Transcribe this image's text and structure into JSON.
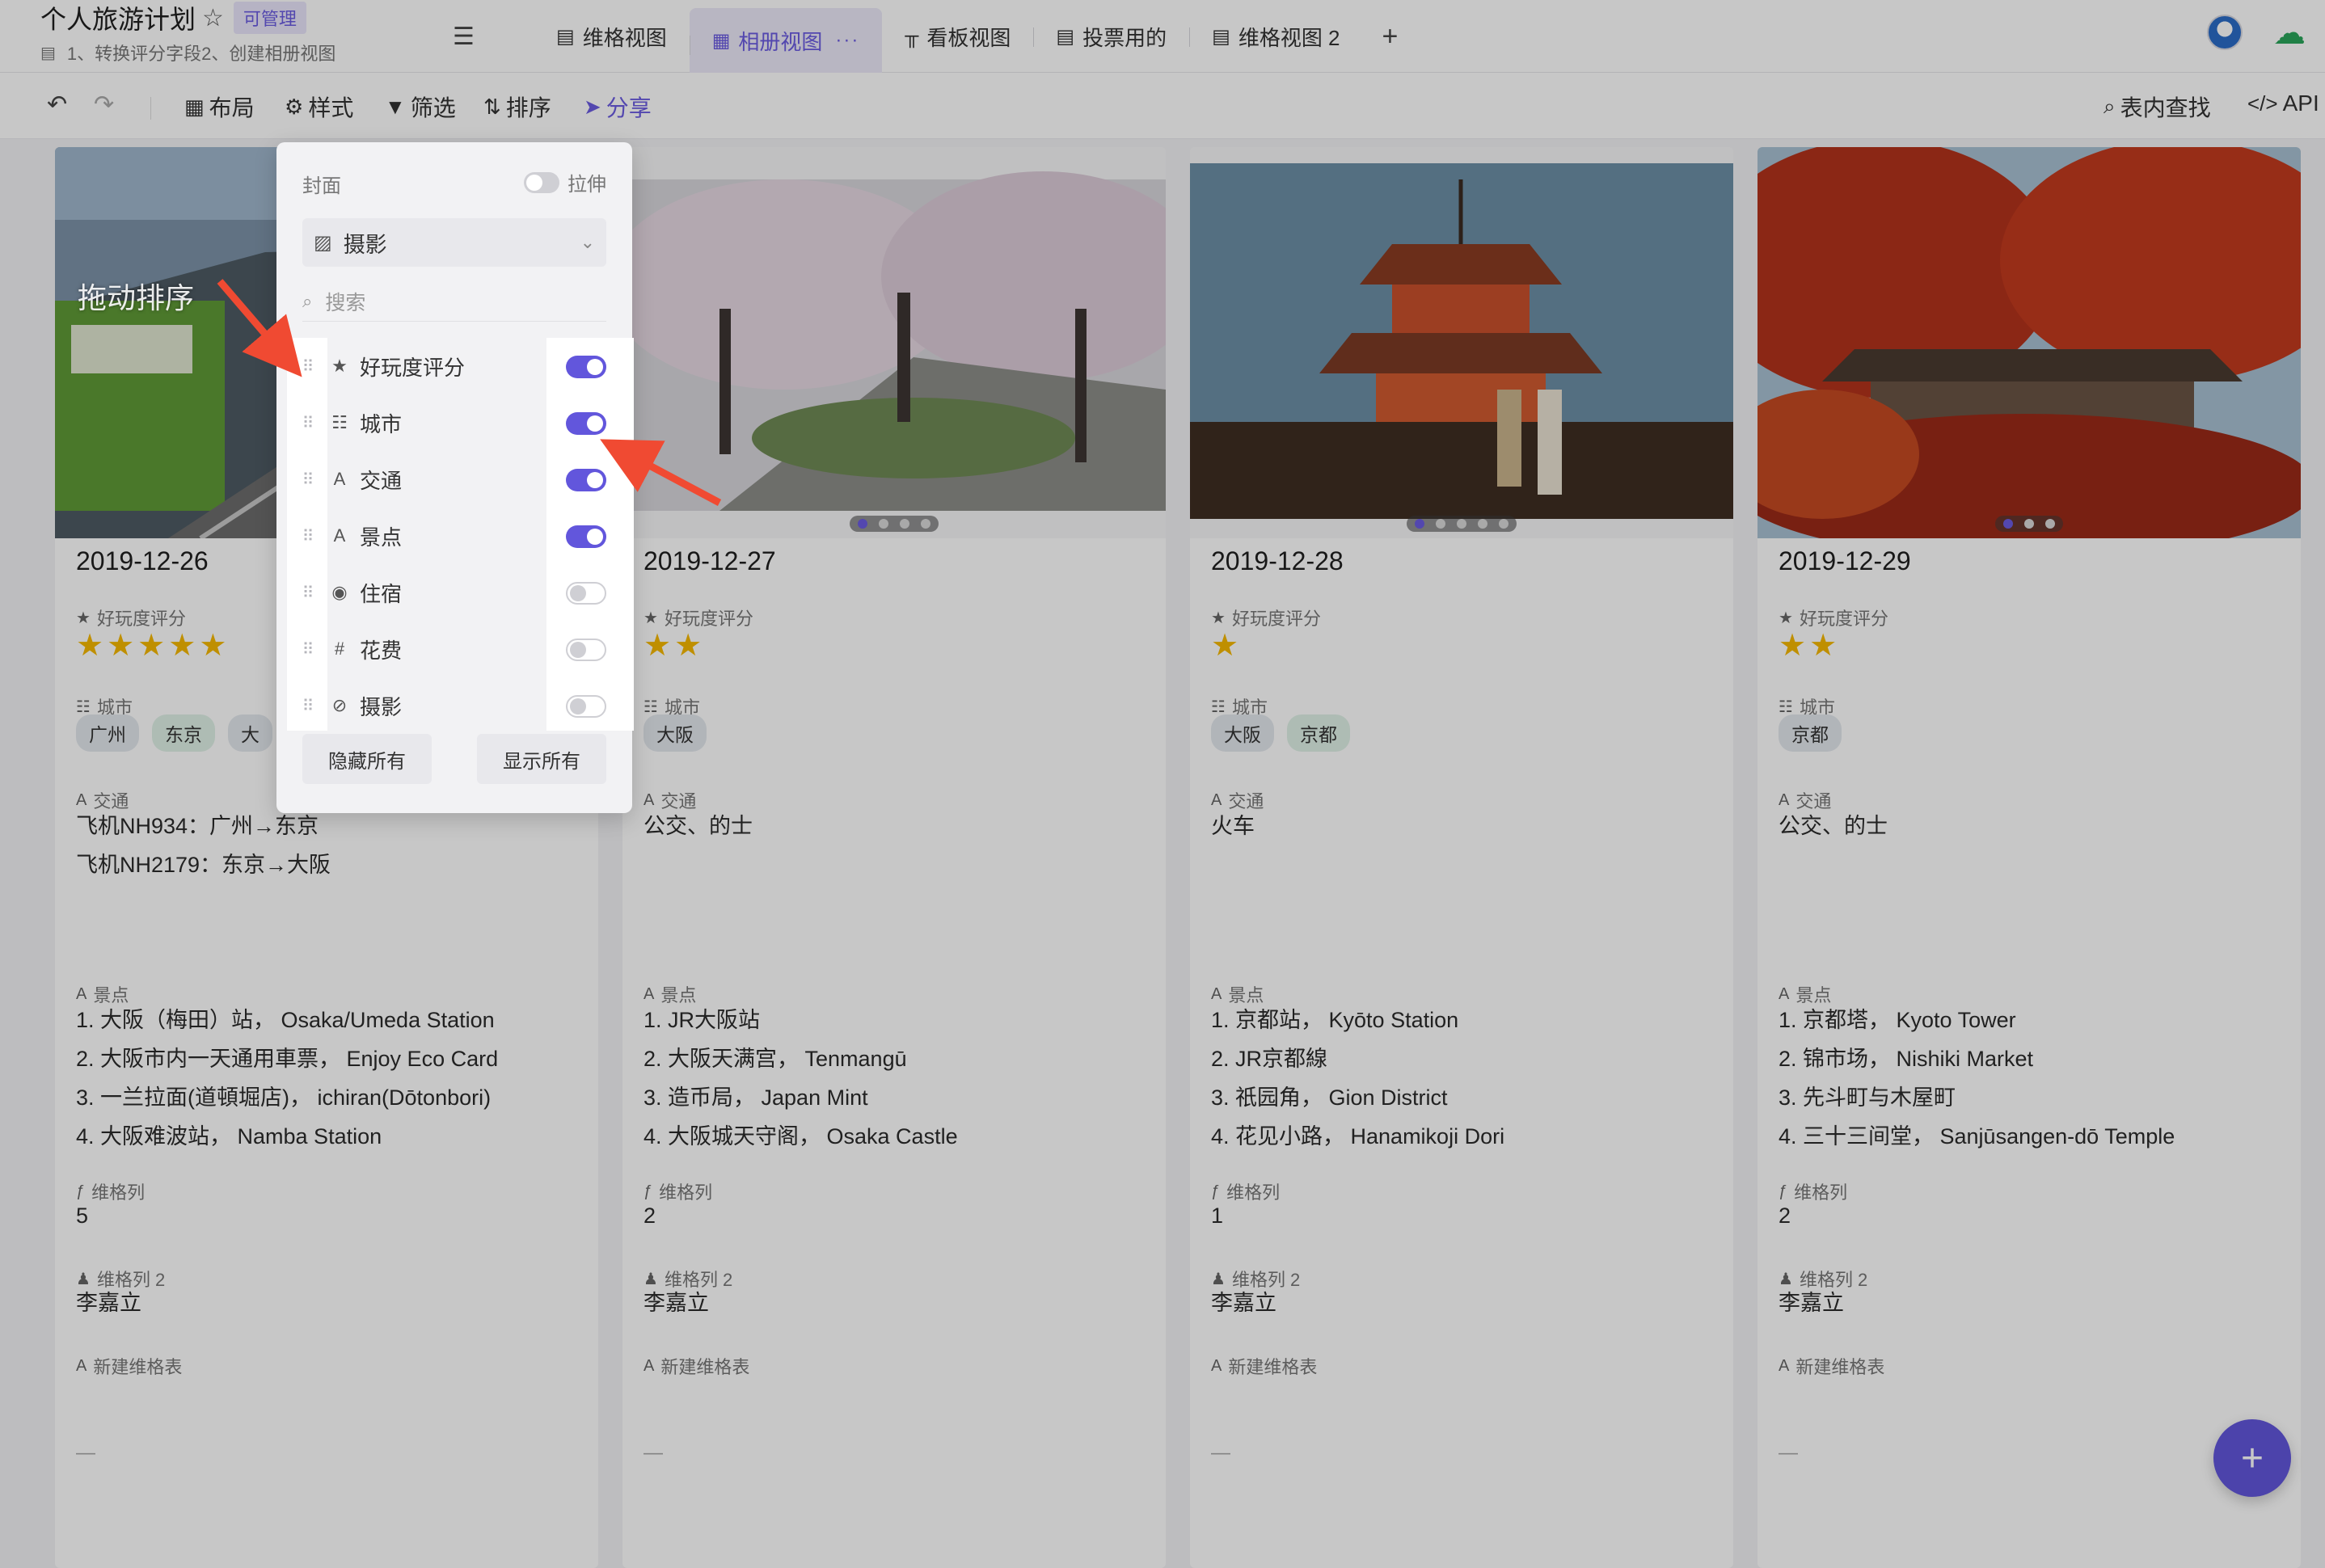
{
  "header": {
    "title": "个人旅游计划",
    "permission_badge": "可管理",
    "description": "1、转换评分字段2、创建相册视图",
    "tabs": [
      {
        "label": "维格视图",
        "icon": "grid-view-icon"
      },
      {
        "label": "相册视图",
        "icon": "gallery-view-icon",
        "active": true
      },
      {
        "label": "看板视图",
        "icon": "kanban-view-icon"
      },
      {
        "label": "投票用的",
        "icon": "grid-view-icon"
      },
      {
        "label": "维格视图 2",
        "icon": "grid-view-icon"
      }
    ],
    "add_tab": "+"
  },
  "toolbar": {
    "layout": "布局",
    "style": "样式",
    "filter": "筛选",
    "sort": "排序",
    "share": "分享",
    "find": "表内查找",
    "api": "API"
  },
  "panel": {
    "cover_label": "封面",
    "stretch_label": "拉伸",
    "cover_select": "摄影",
    "search_placeholder": "搜索",
    "fields": [
      {
        "name": "好玩度评分",
        "icon": "star-icon",
        "visible": true
      },
      {
        "name": "城市",
        "icon": "multi-select-icon",
        "visible": true
      },
      {
        "name": "交通",
        "icon": "text-icon",
        "visible": true
      },
      {
        "name": "景点",
        "icon": "text-icon",
        "visible": true
      },
      {
        "name": "住宿",
        "icon": "single-select-icon",
        "visible": false
      },
      {
        "name": "花费",
        "icon": "number-icon",
        "visible": false
      },
      {
        "name": "摄影",
        "icon": "attachment-icon",
        "visible": false
      }
    ],
    "hide_all": "隐藏所有",
    "show_all": "显示所有"
  },
  "annotation": {
    "drag_sort": "拖动排序"
  },
  "field_labels": {
    "rating": "好玩度评分",
    "city": "城市",
    "traffic": "交通",
    "spots": "景点",
    "formula": "维格列",
    "member": "维格列 2",
    "newsheet": "新建维格表"
  },
  "cards": [
    {
      "date": "2019-12-26",
      "rating": 5,
      "cities": [
        "广州",
        "东京",
        "大"
      ],
      "traffic": [
        "飞机NH934：广州→东京",
        "飞机NH2179：东京→大阪"
      ],
      "spots": [
        "1. 大阪（梅田）站，  Osaka/Umeda Station",
        "2. 大阪市内一天通用車票，  Enjoy Eco Card",
        "3. 一兰拉面(道頓堀店)，  ichiran(Dōtonbori)",
        "4. 大阪难波站，  Namba Station"
      ],
      "formula": "5",
      "member": "李嘉立",
      "newsheet": "—",
      "pager": 0
    },
    {
      "date": "2019-12-27",
      "rating": 2,
      "cities": [
        "大阪"
      ],
      "traffic": [
        "公交、的士"
      ],
      "spots": [
        "1. JR大阪站",
        "2. 大阪天满宫，  Tenmangū",
        "3. 造币局，  Japan Mint",
        "4. 大阪城天守阁，  Osaka Castle"
      ],
      "formula": "2",
      "member": "李嘉立",
      "newsheet": "—",
      "pager": 4
    },
    {
      "date": "2019-12-28",
      "rating": 1,
      "cities": [
        "大阪",
        "京都"
      ],
      "traffic": [
        "火车"
      ],
      "spots": [
        "1. 京都站，  Kyōto Station",
        "2. JR京都線",
        "3. 祇园角，  Gion District",
        "4. 花见小路，  Hanamikoji Dori"
      ],
      "formula": "1",
      "member": "李嘉立",
      "newsheet": "—",
      "pager": 5
    },
    {
      "date": "2019-12-29",
      "rating": 2,
      "cities": [
        "京都"
      ],
      "traffic": [
        "公交、的士"
      ],
      "spots": [
        "1. 京都塔，  Kyoto Tower",
        "2. 锦市场，  Nishiki Market",
        "3. 先斗町与木屋町",
        "4. 三十三间堂，  Sanjūsangen-dō Temple"
      ],
      "formula": "2",
      "member": "李嘉立",
      "newsheet": "—",
      "pager": 3
    }
  ],
  "fab": "+",
  "colors": {
    "accent": "#6256dc",
    "star": "#f5b800",
    "arrow": "#f04a32"
  }
}
